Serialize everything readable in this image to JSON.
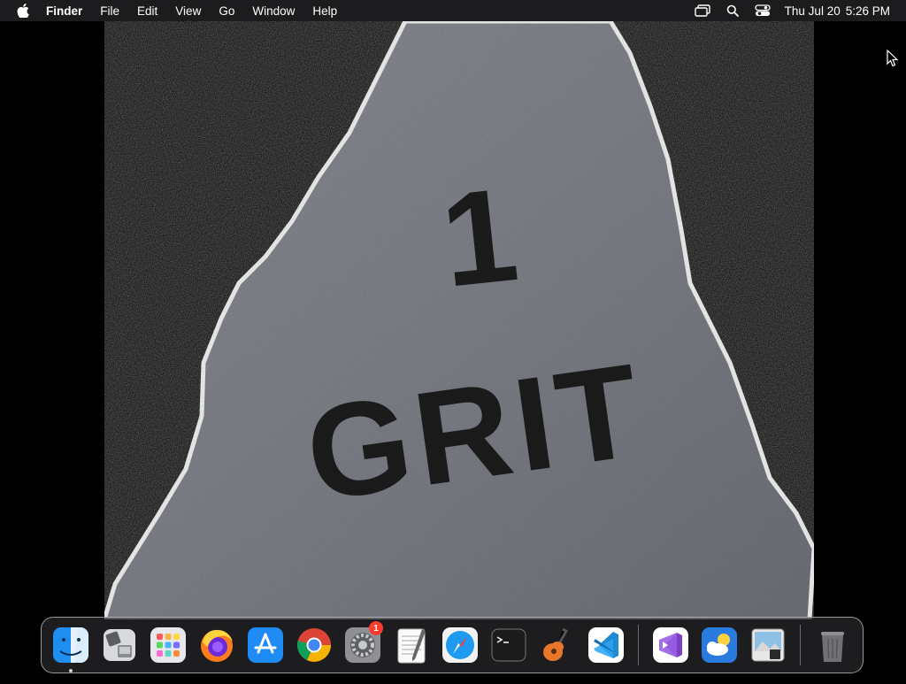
{
  "menubar": {
    "app_name": "Finder",
    "menus": [
      "File",
      "Edit",
      "View",
      "Go",
      "Window",
      "Help"
    ],
    "clock": {
      "date": "Thu Jul 20",
      "time": "5:26 PM"
    }
  },
  "wallpaper": {
    "painted_text_top": "1",
    "painted_text_bottom": "GRIT"
  },
  "dock": {
    "items": [
      {
        "name": "Finder",
        "icon": "finder-icon"
      },
      {
        "name": "Migration Assistant",
        "icon": "migration-assistant-icon"
      },
      {
        "name": "Launchpad",
        "icon": "launchpad-icon"
      },
      {
        "name": "Firefox",
        "icon": "firefox-icon"
      },
      {
        "name": "App Store",
        "icon": "app-store-icon"
      },
      {
        "name": "Google Chrome",
        "icon": "chrome-icon"
      },
      {
        "name": "System Settings",
        "icon": "system-settings-icon",
        "badge": "1"
      },
      {
        "name": "TextEdit",
        "icon": "textedit-icon"
      },
      {
        "name": "Safari",
        "icon": "safari-icon"
      },
      {
        "name": "Terminal",
        "icon": "terminal-icon"
      },
      {
        "name": "GarageBand",
        "icon": "garageband-icon"
      },
      {
        "name": "Visual Studio Code",
        "icon": "vscode-icon"
      },
      {
        "name": "Visual Studio",
        "icon": "visual-studio-icon"
      },
      {
        "name": "Weather",
        "icon": "weather-icon"
      },
      {
        "name": "Preview",
        "icon": "preview-icon"
      },
      {
        "name": "Trash",
        "icon": "trash-icon"
      }
    ]
  }
}
